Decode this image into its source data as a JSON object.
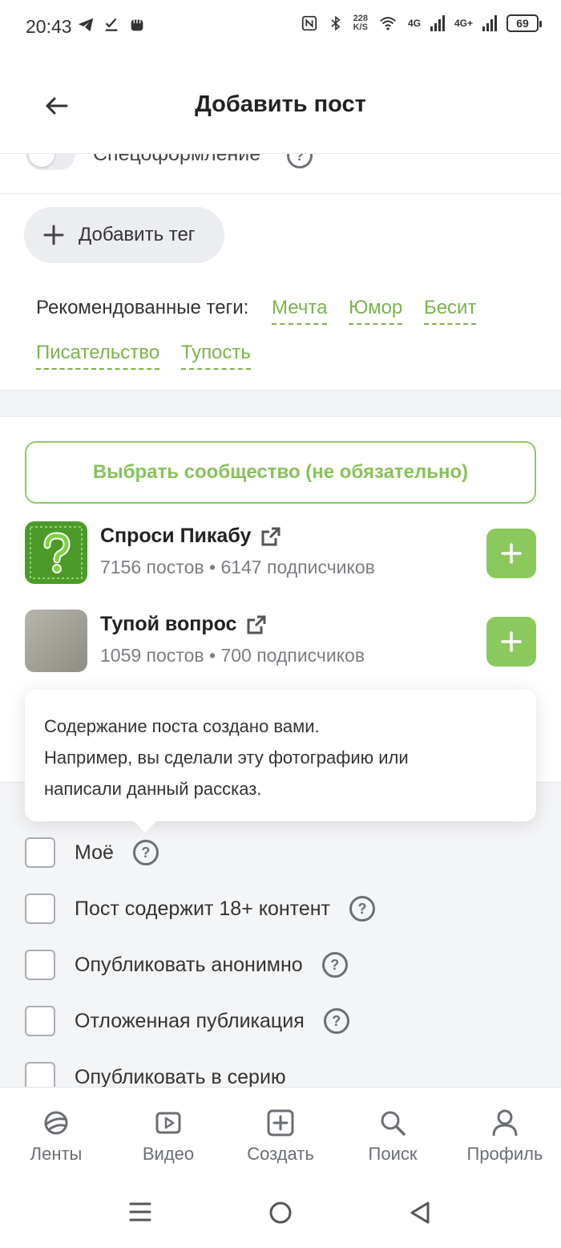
{
  "status_bar": {
    "time": "20:43",
    "net_speed_value": "228",
    "net_speed_unit": "K/S",
    "net1": "4G",
    "net2": "4G+",
    "battery": "69"
  },
  "header": {
    "title": "Добавить пост",
    "back_icon": "arrow-left-icon"
  },
  "special_design": {
    "label": "Спецоформление"
  },
  "tags": {
    "add_label": "Добавить тег",
    "recommended_label": "Рекомендованные теги:",
    "recommended": [
      "Мечта",
      "Юмор",
      "Бесит",
      "Писательство",
      "Тупость"
    ]
  },
  "community": {
    "choose_label": "Выбрать сообщество (не обязательно)",
    "items": [
      {
        "name": "Спроси Пикабу",
        "posts": "7156 постов",
        "subscribers": "6147 подписчиков"
      },
      {
        "name": "Тупой вопрос",
        "posts": "1059 постов",
        "subscribers": "700 подписчиков"
      }
    ],
    "separator": "•"
  },
  "tooltip": {
    "line1": "Содержание поста создано вами.",
    "line2": "Например, вы сделали эту фотографию или",
    "line3": "написали данный рассказ."
  },
  "options": [
    {
      "label": "Моё",
      "help": true
    },
    {
      "label": "Пост содержит 18+ контент",
      "help": true
    },
    {
      "label": "Опубликовать анонимно",
      "help": true
    },
    {
      "label": "Отложенная публикация",
      "help": true
    },
    {
      "label": "Опубликовать в серию",
      "help": false
    }
  ],
  "bottom_nav": [
    {
      "label": "Ленты",
      "icon": "feeds-icon"
    },
    {
      "label": "Видео",
      "icon": "video-icon"
    },
    {
      "label": "Создать",
      "icon": "create-icon"
    },
    {
      "label": "Поиск",
      "icon": "search-icon"
    },
    {
      "label": "Профиль",
      "icon": "profile-icon"
    }
  ],
  "colors": {
    "accent": "#8bc95d",
    "accent_text": "#7bb24d"
  }
}
